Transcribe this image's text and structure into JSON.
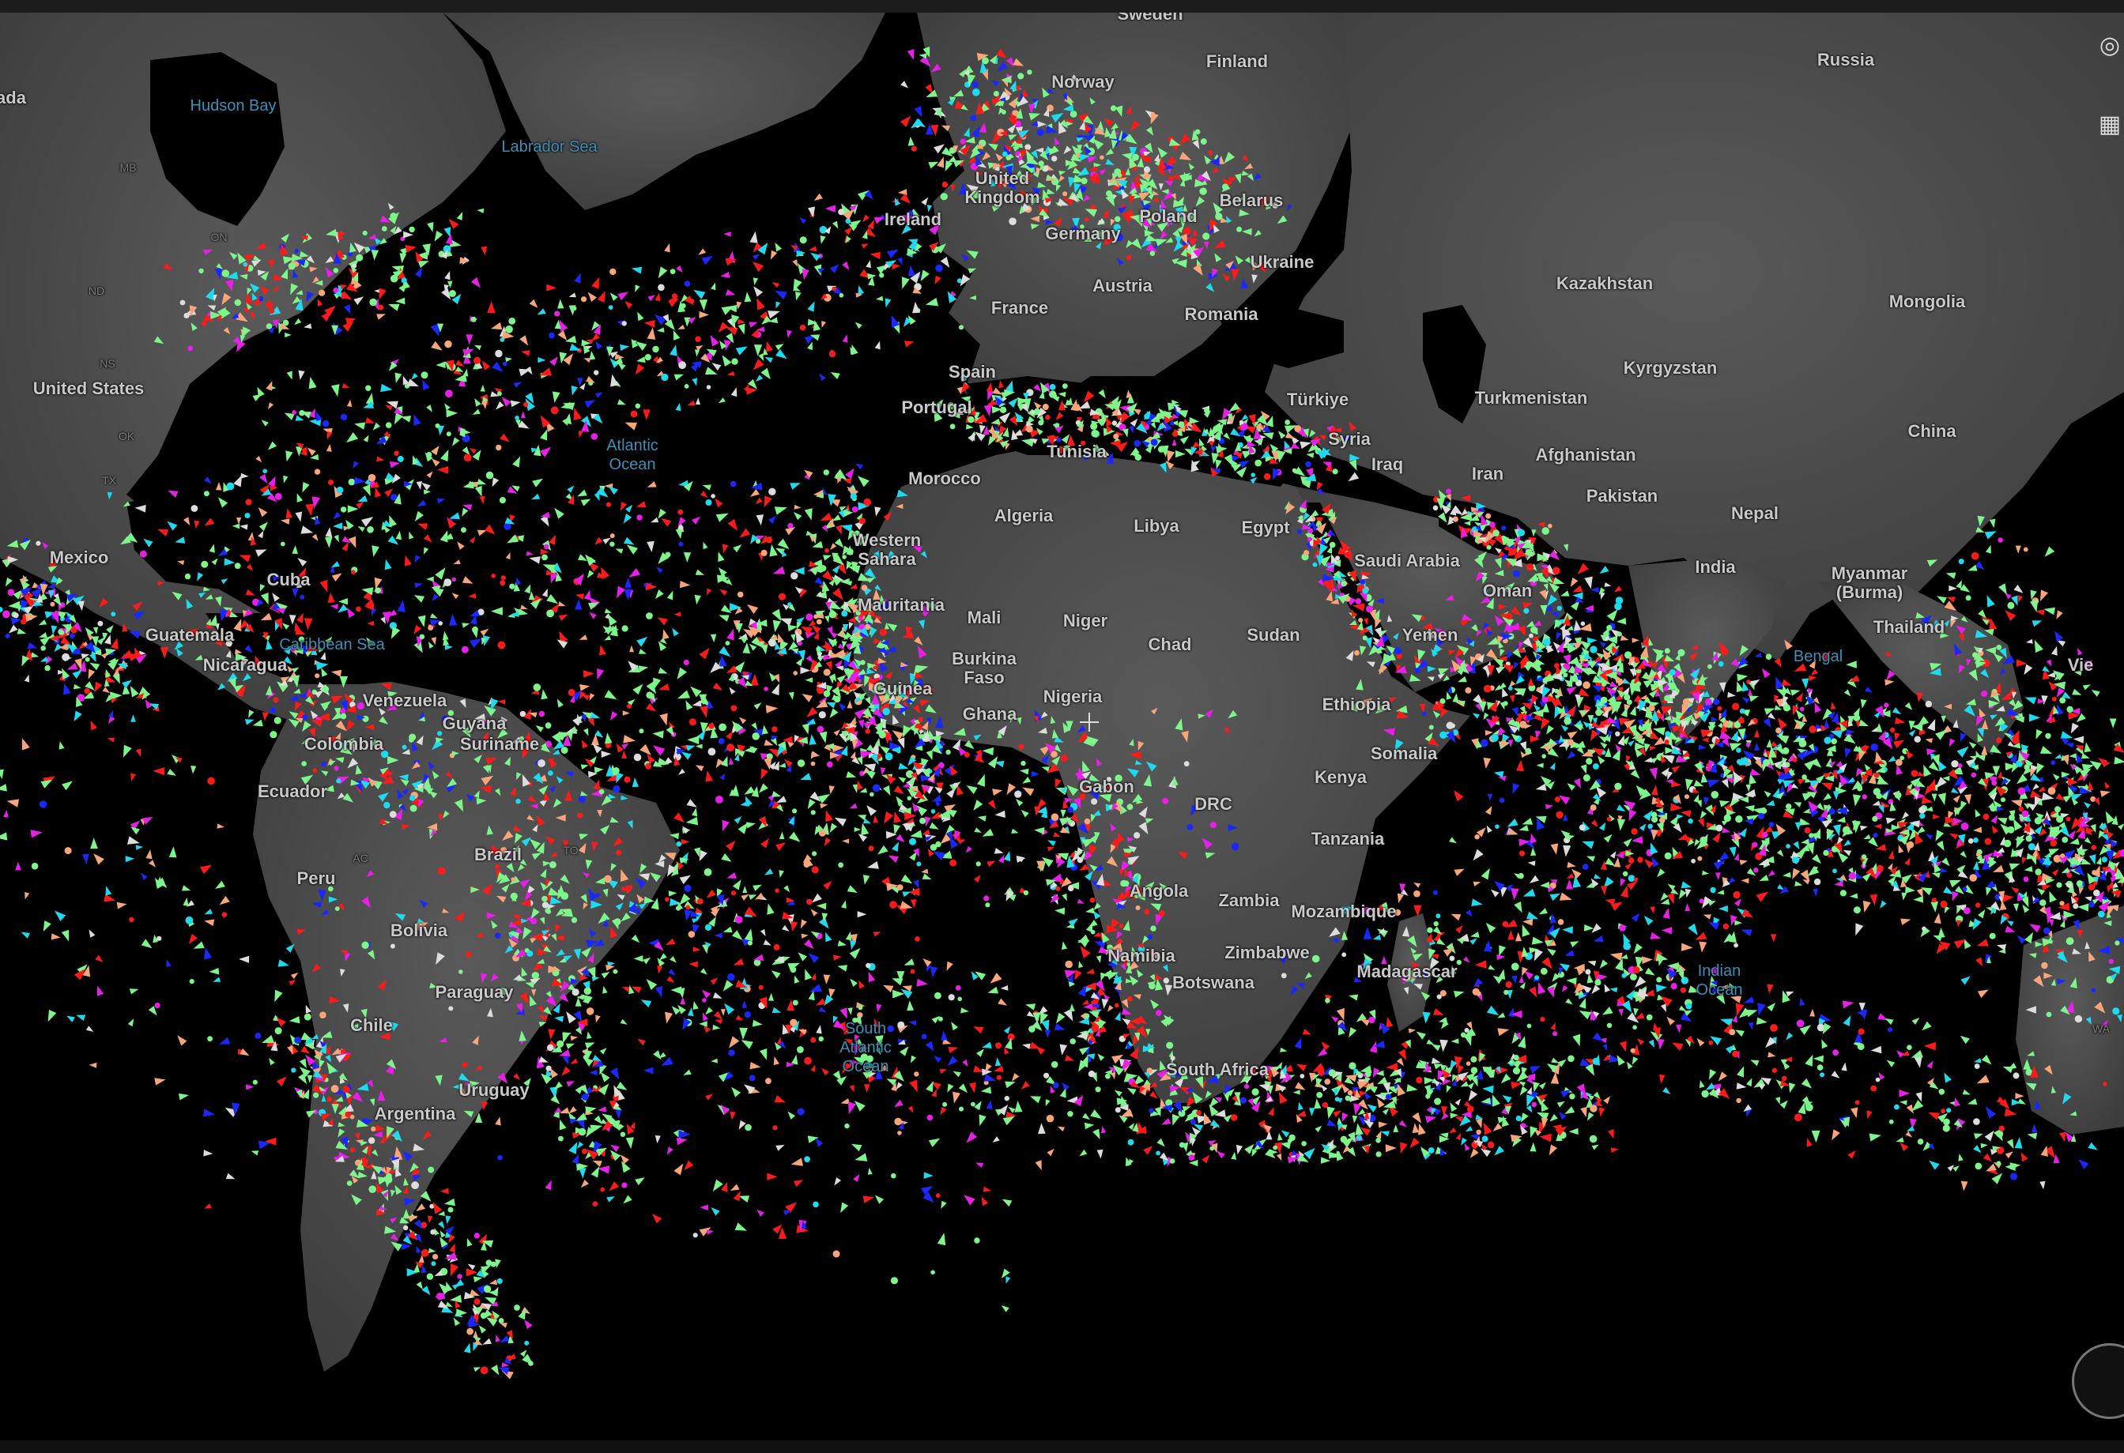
{
  "map": {
    "labels": [
      {
        "key": "hudson_bay",
        "text": "Hudson Bay",
        "kind": "water"
      },
      {
        "key": "labrador_sea",
        "text": "Labrador Sea",
        "kind": "water"
      },
      {
        "key": "atlantic",
        "text": "Atlantic\nOcean",
        "kind": "water"
      },
      {
        "key": "south_atlantic",
        "text": "South\nAtlantic\nOcean",
        "kind": "water"
      },
      {
        "key": "indian_ocean",
        "text": "Indian\nOcean",
        "kind": "water"
      },
      {
        "key": "caribbean",
        "text": "Caribbean Sea",
        "kind": "water"
      },
      {
        "key": "bay_bengal",
        "text": "Bengal",
        "kind": "water"
      },
      {
        "key": "canada",
        "text": "ada",
        "kind": "country"
      },
      {
        "key": "united_states",
        "text": "United States",
        "kind": "country"
      },
      {
        "key": "mexico",
        "text": "Mexico",
        "kind": "country"
      },
      {
        "key": "cuba",
        "text": "Cuba",
        "kind": "country"
      },
      {
        "key": "guatemala",
        "text": "Guatemala",
        "kind": "country"
      },
      {
        "key": "nicaragua",
        "text": "Nicaragua",
        "kind": "country"
      },
      {
        "key": "venezuela",
        "text": "Venezuela",
        "kind": "country"
      },
      {
        "key": "guyana",
        "text": "Guyana",
        "kind": "country"
      },
      {
        "key": "suriname",
        "text": "Suriname",
        "kind": "country"
      },
      {
        "key": "colombia",
        "text": "Colombia",
        "kind": "country"
      },
      {
        "key": "ecuador",
        "text": "Ecuador",
        "kind": "country"
      },
      {
        "key": "peru",
        "text": "Peru",
        "kind": "country"
      },
      {
        "key": "brazil",
        "text": "Brazil",
        "kind": "country"
      },
      {
        "key": "bolivia",
        "text": "Bolivia",
        "kind": "country"
      },
      {
        "key": "paraguay",
        "text": "Paraguay",
        "kind": "country"
      },
      {
        "key": "chile",
        "text": "Chile",
        "kind": "country"
      },
      {
        "key": "uruguay",
        "text": "Uruguay",
        "kind": "country"
      },
      {
        "key": "argentina",
        "text": "Argentina",
        "kind": "country"
      },
      {
        "key": "ireland",
        "text": "Ireland",
        "kind": "country"
      },
      {
        "key": "united_kingdom",
        "text": "United\nKingdom",
        "kind": "country"
      },
      {
        "key": "france",
        "text": "France",
        "kind": "country"
      },
      {
        "key": "spain",
        "text": "Spain",
        "kind": "country"
      },
      {
        "key": "portugal",
        "text": "Portugal",
        "kind": "country"
      },
      {
        "key": "germany",
        "text": "Germany",
        "kind": "country"
      },
      {
        "key": "poland",
        "text": "Poland",
        "kind": "country"
      },
      {
        "key": "austria",
        "text": "Austria",
        "kind": "country"
      },
      {
        "key": "belarus",
        "text": "Belarus",
        "kind": "country"
      },
      {
        "key": "ukraine",
        "text": "Ukraine",
        "kind": "country"
      },
      {
        "key": "romania",
        "text": "Romania",
        "kind": "country"
      },
      {
        "key": "sweden",
        "text": "Sweden",
        "kind": "country"
      },
      {
        "key": "finland",
        "text": "Finland",
        "kind": "country"
      },
      {
        "key": "norway",
        "text": "Norway",
        "kind": "country"
      },
      {
        "key": "russia",
        "text": "Russia",
        "kind": "country"
      },
      {
        "key": "kazakhstan",
        "text": "Kazakhstan",
        "kind": "country"
      },
      {
        "key": "mongolia",
        "text": "Mongolia",
        "kind": "country"
      },
      {
        "key": "kyrgyzstan",
        "text": "Kyrgyzstan",
        "kind": "country"
      },
      {
        "key": "turkmenistan",
        "text": "Turkmenistan",
        "kind": "country"
      },
      {
        "key": "turkiye",
        "text": "Türkiye",
        "kind": "country"
      },
      {
        "key": "syria",
        "text": "Syria",
        "kind": "country"
      },
      {
        "key": "iraq",
        "text": "Iraq",
        "kind": "country"
      },
      {
        "key": "iran",
        "text": "Iran",
        "kind": "country"
      },
      {
        "key": "afghanistan",
        "text": "Afghanistan",
        "kind": "country"
      },
      {
        "key": "pakistan",
        "text": "Pakistan",
        "kind": "country"
      },
      {
        "key": "china",
        "text": "China",
        "kind": "country"
      },
      {
        "key": "nepal",
        "text": "Nepal",
        "kind": "country"
      },
      {
        "key": "india",
        "text": "India",
        "kind": "country"
      },
      {
        "key": "myanmar",
        "text": "Myanmar\n(Burma)",
        "kind": "country"
      },
      {
        "key": "thailand",
        "text": "Thailand",
        "kind": "country"
      },
      {
        "key": "vietnam",
        "text": "Vie",
        "kind": "country"
      },
      {
        "key": "saudi_arabia",
        "text": "Saudi Arabia",
        "kind": "country"
      },
      {
        "key": "oman",
        "text": "Oman",
        "kind": "country"
      },
      {
        "key": "yemen",
        "text": "Yemen",
        "kind": "country"
      },
      {
        "key": "morocco",
        "text": "Morocco",
        "kind": "country"
      },
      {
        "key": "tunisia",
        "text": "Tunisia",
        "kind": "country"
      },
      {
        "key": "algeria",
        "text": "Algeria",
        "kind": "country"
      },
      {
        "key": "libya",
        "text": "Libya",
        "kind": "country"
      },
      {
        "key": "egypt",
        "text": "Egypt",
        "kind": "country"
      },
      {
        "key": "western_sahara",
        "text": "Western\nSahara",
        "kind": "country"
      },
      {
        "key": "mauritania",
        "text": "Mauritania",
        "kind": "country"
      },
      {
        "key": "mali",
        "text": "Mali",
        "kind": "country"
      },
      {
        "key": "niger",
        "text": "Niger",
        "kind": "country"
      },
      {
        "key": "chad",
        "text": "Chad",
        "kind": "country"
      },
      {
        "key": "sudan",
        "text": "Sudan",
        "kind": "country"
      },
      {
        "key": "burkina_faso",
        "text": "Burkina\nFaso",
        "kind": "country"
      },
      {
        "key": "guinea",
        "text": "Guinea",
        "kind": "country"
      },
      {
        "key": "ghana",
        "text": "Ghana",
        "kind": "country"
      },
      {
        "key": "nigeria",
        "text": "Nigeria",
        "kind": "country"
      },
      {
        "key": "ethiopia",
        "text": "Ethiopia",
        "kind": "country"
      },
      {
        "key": "somalia",
        "text": "Somalia",
        "kind": "country"
      },
      {
        "key": "kenya",
        "text": "Kenya",
        "kind": "country"
      },
      {
        "key": "gabon",
        "text": "Gabon",
        "kind": "country"
      },
      {
        "key": "drc",
        "text": "DRC",
        "kind": "country"
      },
      {
        "key": "tanzania",
        "text": "Tanzania",
        "kind": "country"
      },
      {
        "key": "angola",
        "text": "Angola",
        "kind": "country"
      },
      {
        "key": "zambia",
        "text": "Zambia",
        "kind": "country"
      },
      {
        "key": "mozambique",
        "text": "Mozambique",
        "kind": "country"
      },
      {
        "key": "zimbabwe",
        "text": "Zimbabwe",
        "kind": "country"
      },
      {
        "key": "namibia",
        "text": "Namibia",
        "kind": "country"
      },
      {
        "key": "botswana",
        "text": "Botswana",
        "kind": "country"
      },
      {
        "key": "madagascar",
        "text": "Madagascar",
        "kind": "country"
      },
      {
        "key": "south_africa",
        "text": "South Africa",
        "kind": "country"
      },
      {
        "key": "mb",
        "text": "MB",
        "kind": "state"
      },
      {
        "key": "on",
        "text": "ON",
        "kind": "state"
      },
      {
        "key": "nd",
        "text": "ND",
        "kind": "state"
      },
      {
        "key": "ns",
        "text": "NS",
        "kind": "state"
      },
      {
        "key": "ok",
        "text": "OK",
        "kind": "state"
      },
      {
        "key": "tx",
        "text": "TX",
        "kind": "state"
      },
      {
        "key": "ac",
        "text": "AC",
        "kind": "state"
      },
      {
        "key": "to",
        "text": "TO",
        "kind": "state"
      },
      {
        "key": "wa",
        "text": "WA",
        "kind": "state"
      }
    ],
    "vessel_colors": {
      "cargo": "#7df58a",
      "tanker": "#ff1a1a",
      "passenger": "#1b27ff",
      "fishing": "#f8a57a",
      "pleasure": "#e81fe8",
      "tug_special": "#1fd9ee",
      "high_speed": "#f4e41b",
      "unspecified": "#dcdcdc"
    },
    "controls": {
      "locate_icon": "target-icon",
      "layers_icon": "layers-icon"
    }
  }
}
